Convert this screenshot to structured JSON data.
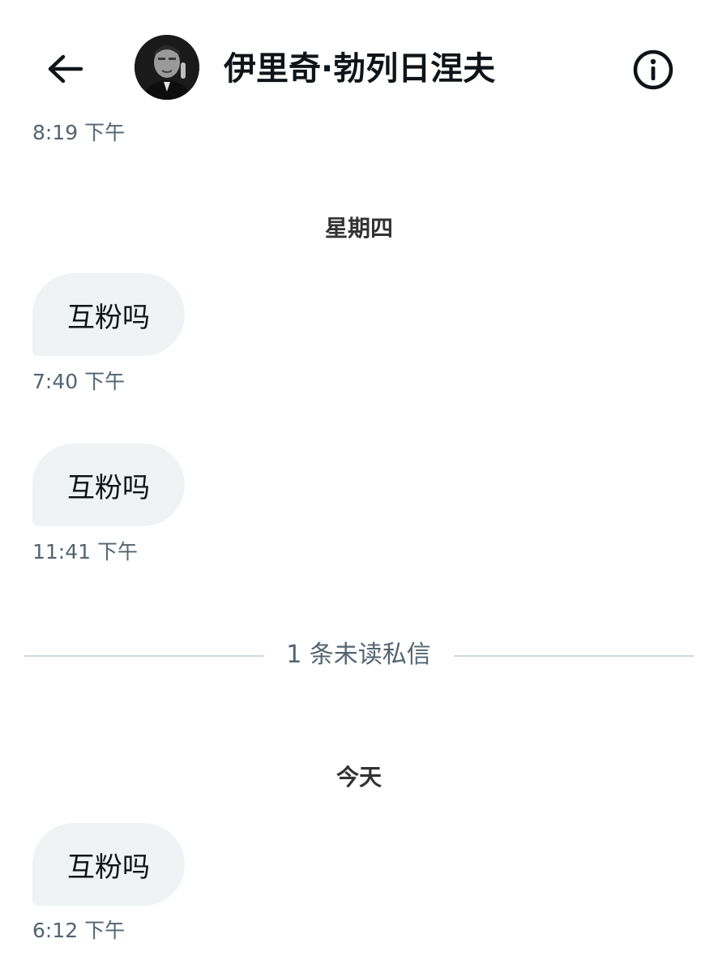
{
  "header": {
    "contact_name": "伊里奇·勃列日涅夫"
  },
  "conversation": {
    "top_timestamp": "8:19 下午",
    "days": [
      {
        "label": "星期四",
        "messages": [
          {
            "text": "互粉吗",
            "time": "7:40 下午"
          },
          {
            "text": "互粉吗",
            "time": "11:41 下午"
          }
        ]
      },
      {
        "label": "今天",
        "messages": [
          {
            "text": "互粉吗",
            "time": "6:12 下午"
          }
        ]
      }
    ],
    "unread_divider": "1 条未读私信"
  }
}
